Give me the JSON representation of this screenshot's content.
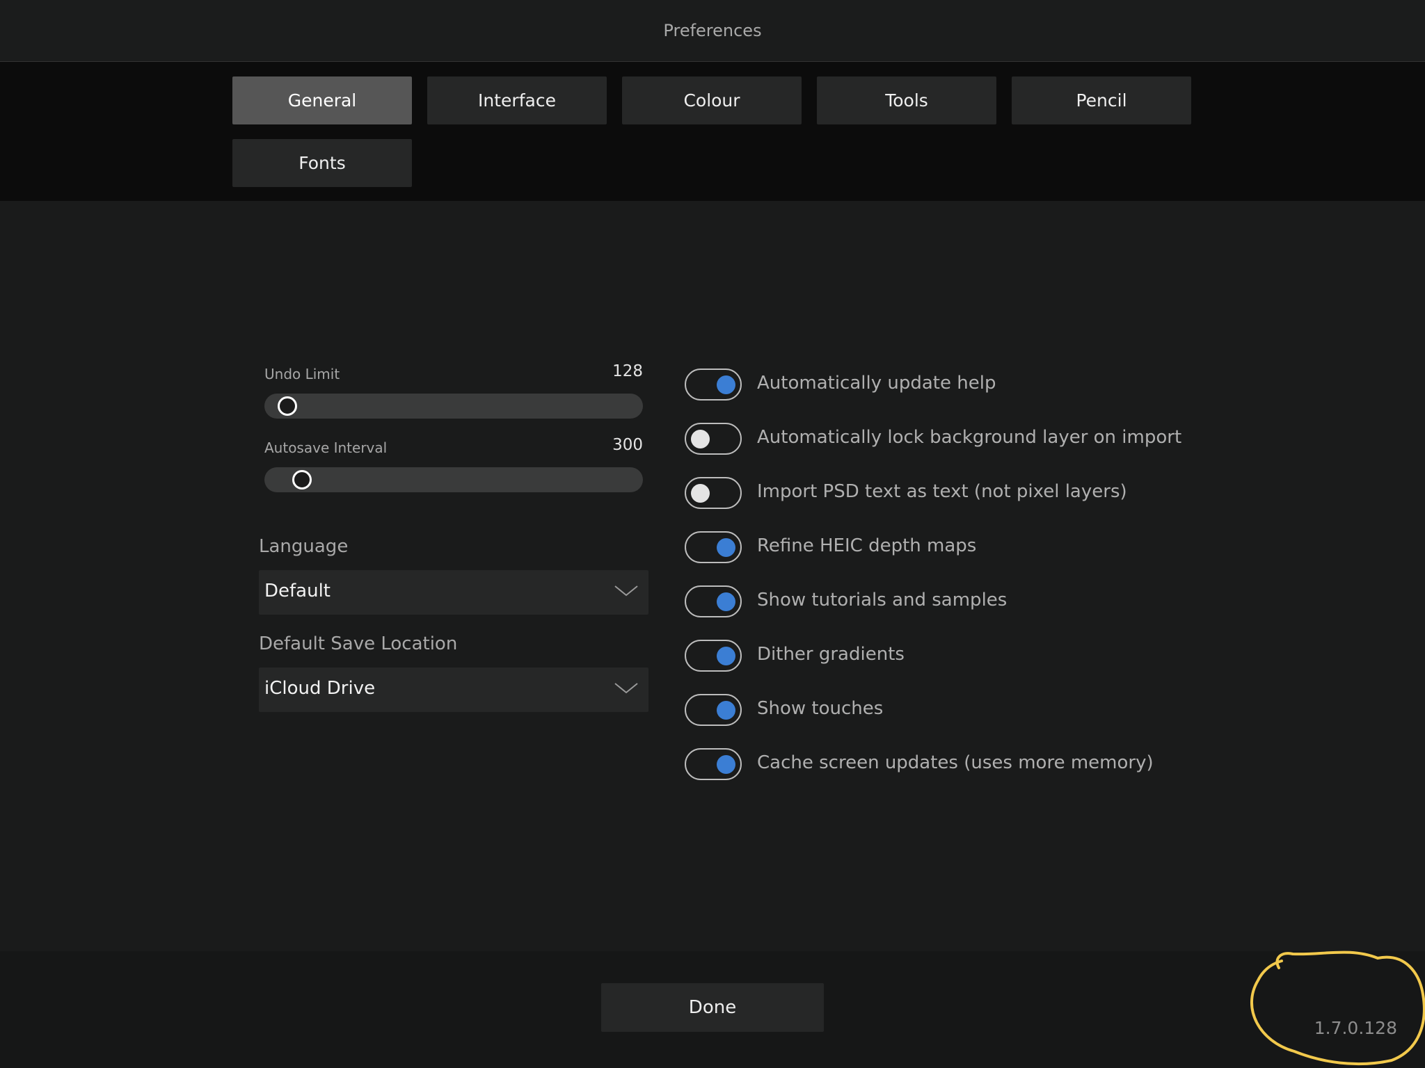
{
  "window": {
    "title": "Preferences"
  },
  "tabs": [
    {
      "label": "General",
      "active": true
    },
    {
      "label": "Interface",
      "active": false
    },
    {
      "label": "Colour",
      "active": false
    },
    {
      "label": "Tools",
      "active": false
    },
    {
      "label": "Pencil",
      "active": false
    },
    {
      "label": "Fonts",
      "active": false
    }
  ],
  "sliders": {
    "undo_limit": {
      "label": "Undo Limit",
      "value": "128",
      "position_fraction": 0.06
    },
    "autosave_interval": {
      "label": "Autosave Interval",
      "value": "300",
      "position_fraction": 0.1
    }
  },
  "language": {
    "label": "Language",
    "selected": "Default"
  },
  "save_location": {
    "label": "Default Save Location",
    "selected": "iCloud Drive"
  },
  "toggles": [
    {
      "label": "Automatically update help",
      "on": true
    },
    {
      "label": "Automatically lock background layer on import",
      "on": false
    },
    {
      "label": "Import PSD text as text (not pixel layers)",
      "on": false
    },
    {
      "label": "Refine HEIC depth maps",
      "on": true
    },
    {
      "label": "Show tutorials and samples",
      "on": true
    },
    {
      "label": "Dither gradients",
      "on": true
    },
    {
      "label": "Show touches",
      "on": true
    },
    {
      "label": "Cache screen updates (uses more memory)",
      "on": true
    }
  ],
  "footer": {
    "done_label": "Done",
    "version": "1.7.0.128"
  },
  "colors": {
    "accent": "#3b7ed4",
    "annotation": "#f2c94c"
  },
  "icons": {
    "dropdown": "chevron-down-icon"
  }
}
